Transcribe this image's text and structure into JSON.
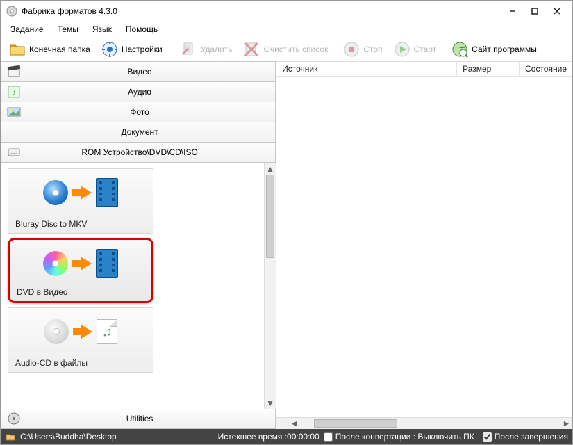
{
  "title": "Фабрика форматов 4.3.0",
  "menu": {
    "tasks": "Задание",
    "themes": "Темы",
    "lang": "Язык",
    "help": "Помощь"
  },
  "toolbar": {
    "outfolder": "Конечная папка",
    "settings": "Настройки",
    "delete": "Удалить",
    "clear": "Очистить список",
    "stop": "Стоп",
    "start": "Старт",
    "site": "Сайт программы"
  },
  "categories": {
    "video": "Видео",
    "audio": "Аудио",
    "photo": "Фото",
    "document": "Документ",
    "rom": "ROM Устройство\\DVD\\CD\\ISO",
    "utilities": "Utilities"
  },
  "tiles": {
    "bluray": "Bluray Disc to MKV",
    "dvd": "DVD в Видео",
    "audiocd": "Audio-CD в файлы"
  },
  "columns": {
    "source": "Источник",
    "size": "Размер",
    "state": "Состояние"
  },
  "status": {
    "path": "C:\\Users\\Buddha\\Desktop",
    "elapsed_label": "Истекшее время : ",
    "elapsed_value": "00:00:00",
    "after_conv_label": "После конвертации : Выключить ПК",
    "after_done_label": "После завершения"
  }
}
